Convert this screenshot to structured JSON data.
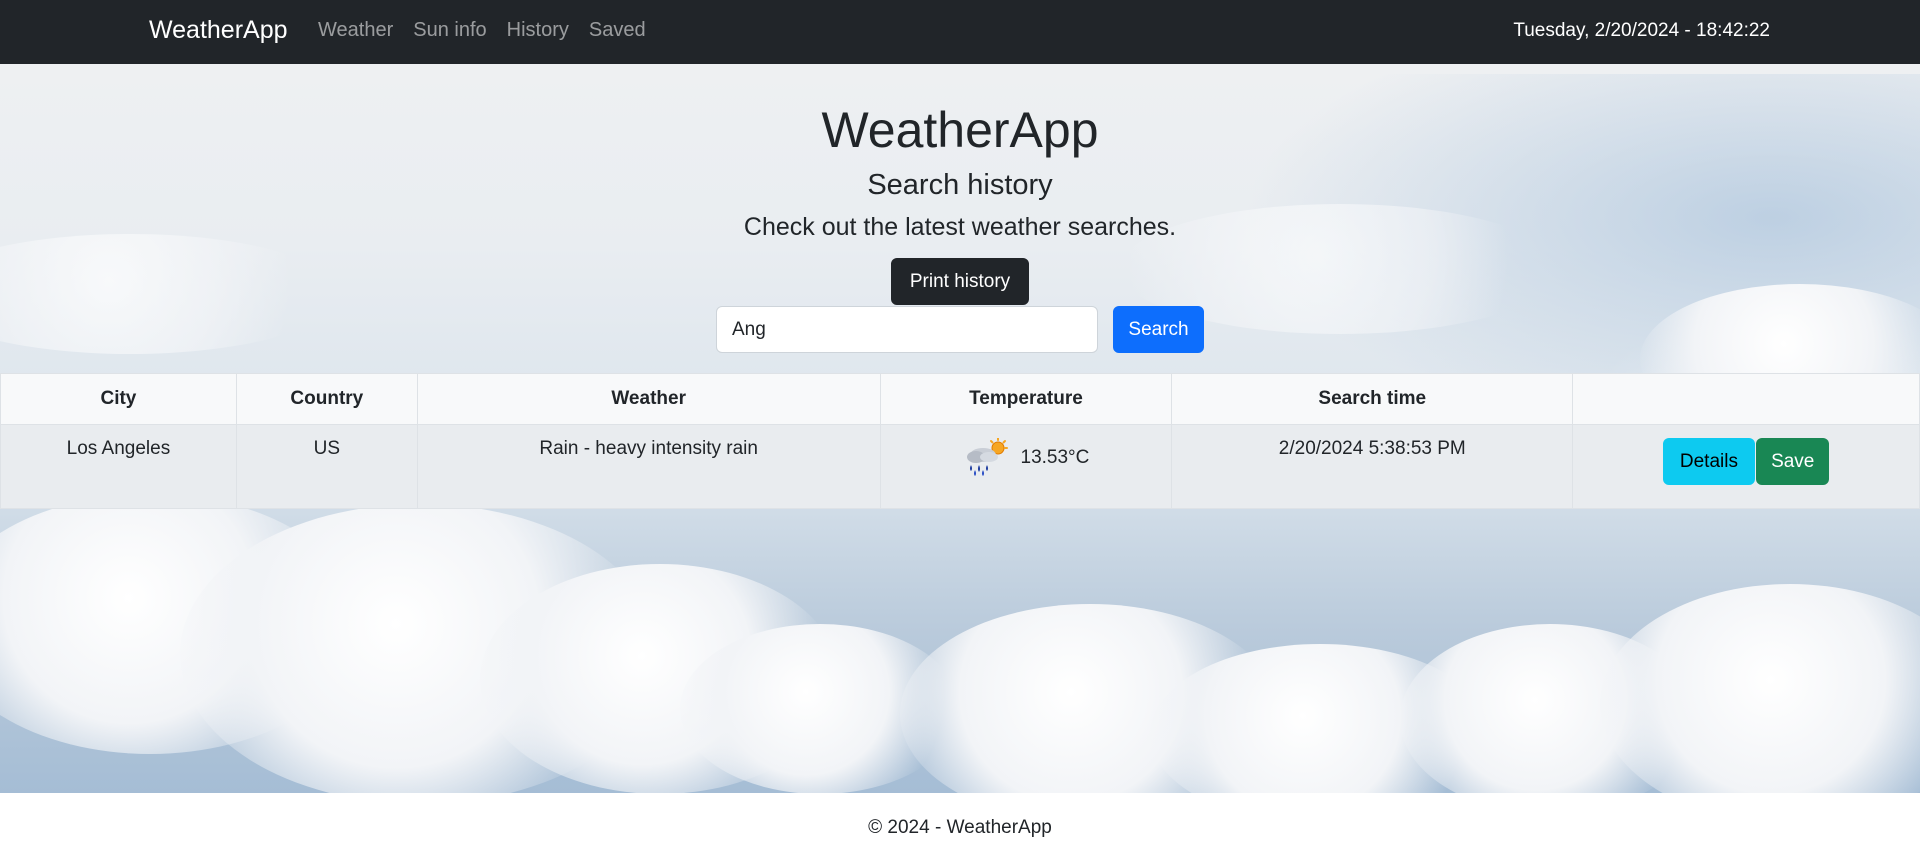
{
  "navbar": {
    "brand": "WeatherApp",
    "links": [
      "Weather",
      "Sun info",
      "History",
      "Saved"
    ],
    "clock": "Tuesday, 2/20/2024 - 18:42:22"
  },
  "hero": {
    "title": "WeatherApp",
    "subtitle": "Search history",
    "description": "Check out the latest weather searches."
  },
  "controls": {
    "print_label": "Print history",
    "search_value": "Ang",
    "search_label": "Search"
  },
  "table": {
    "headers": [
      "City",
      "Country",
      "Weather",
      "Temperature",
      "Search time",
      ""
    ],
    "rows": [
      {
        "city": "Los Angeles",
        "country": "US",
        "weather": "Rain - heavy intensity rain",
        "weather_icon": "rain-sun-icon",
        "temperature": "13.53°C",
        "search_time": "2/20/2024 5:38:53 PM",
        "details_label": "Details",
        "save_label": "Save"
      }
    ]
  },
  "footer": {
    "text": "© 2024 - WeatherApp"
  },
  "colors": {
    "navbar": "#212529",
    "primary": "#0d6efd",
    "info": "#0dcaf0",
    "success": "#198754",
    "dark_button": "#212529"
  }
}
